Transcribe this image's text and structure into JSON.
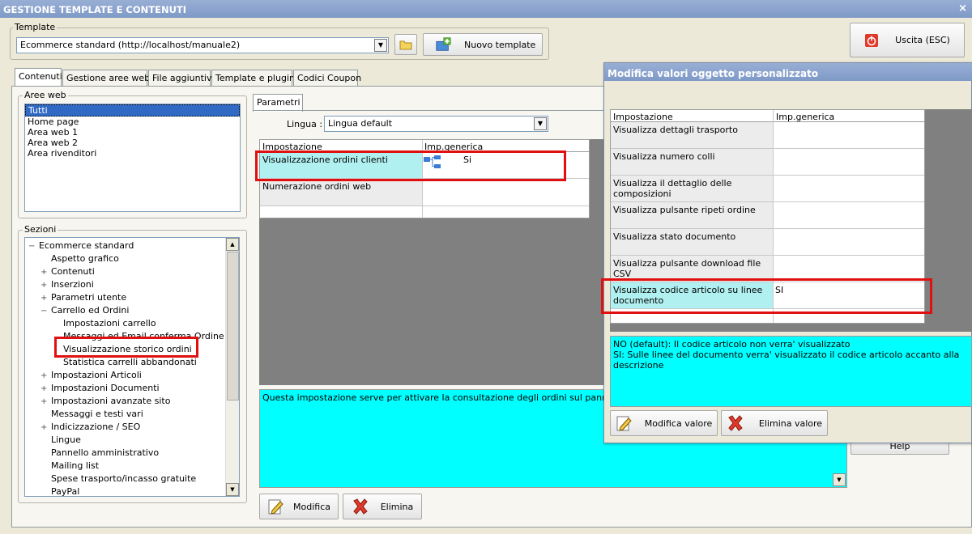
{
  "window": {
    "title": "GESTIONE TEMPLATE E CONTENUTI",
    "close": "×"
  },
  "template": {
    "group_label": "Template",
    "selected": "Ecommerce standard (http://localhost/manuale2)",
    "new_button": "Nuovo template"
  },
  "exit_button": "Uscita (ESC)",
  "tabs": [
    "Contenuti",
    "Gestione aree web",
    "File aggiuntivi",
    "Template e plugins",
    "Codici Coupon"
  ],
  "aree_web": {
    "label": "Aree web",
    "items": [
      "Tutti",
      "Home page",
      "Area web 1",
      "Area web 2",
      "Area rivenditori"
    ],
    "selected_index": 0
  },
  "sezioni": {
    "label": "Sezioni",
    "items": [
      {
        "label": "Ecommerce standard",
        "pm": "−",
        "level": 0
      },
      {
        "label": "Aspetto grafico",
        "pm": "",
        "level": 1
      },
      {
        "label": "Contenuti",
        "pm": "+",
        "level": 1
      },
      {
        "label": "Inserzioni",
        "pm": "+",
        "level": 1
      },
      {
        "label": "Parametri utente",
        "pm": "+",
        "level": 1
      },
      {
        "label": "Carrello ed Ordini",
        "pm": "−",
        "level": 1
      },
      {
        "label": "Impostazioni carrello",
        "pm": "",
        "level": 2
      },
      {
        "label": "Messaggi ed Email conferma Ordine",
        "pm": "",
        "level": 2
      },
      {
        "label": "Visualizzazione storico ordini",
        "pm": "",
        "level": 2
      },
      {
        "label": "Statistica carrelli abbandonati",
        "pm": "",
        "level": 2
      },
      {
        "label": "Impostazioni Articoli",
        "pm": "+",
        "level": 1
      },
      {
        "label": "Impostazioni Documenti",
        "pm": "+",
        "level": 1
      },
      {
        "label": "Impostazioni avanzate sito",
        "pm": "+",
        "level": 1
      },
      {
        "label": "Messaggi e testi vari",
        "pm": "",
        "level": 1
      },
      {
        "label": "Indicizzazione / SEO",
        "pm": "+",
        "level": 1
      },
      {
        "label": "Lingue",
        "pm": "",
        "level": 1
      },
      {
        "label": "Pannello amministrativo",
        "pm": "",
        "level": 1
      },
      {
        "label": "Mailing list",
        "pm": "",
        "level": 1
      },
      {
        "label": "Spese trasporto/incasso gratuite",
        "pm": "",
        "level": 1
      },
      {
        "label": "PayPal",
        "pm": "",
        "level": 1
      }
    ]
  },
  "parametri": {
    "tab": "Parametri",
    "lingua_label": "Lingua :",
    "lingua_value": "Lingua default",
    "col_impostazione": "Impostazione",
    "col_imp": "Imp.generica",
    "rows": [
      {
        "name": "Visualizzazione ordini clienti",
        "value": "Si"
      },
      {
        "name": "Numerazione ordini web",
        "value": ""
      }
    ],
    "description": "Questa impostazione serve per attivare la consultazione degli ordini sul pannello dell'utente",
    "modifica": "Modifica",
    "elimina": "Elimina",
    "help": "Help"
  },
  "dialog": {
    "title": "Modifica valori oggetto personalizzato",
    "col_impostazione": "Impostazione",
    "col_imp": "Imp.generica",
    "rows": [
      {
        "name": "Visualizza dettagli trasporto",
        "value": ""
      },
      {
        "name": "Visualizza numero colli",
        "value": ""
      },
      {
        "name": "Visualizza il dettaglio delle composizioni",
        "value": ""
      },
      {
        "name": "Visualizza pulsante ripeti ordine",
        "value": ""
      },
      {
        "name": "Visualizza stato documento",
        "value": ""
      },
      {
        "name": "Visualizza pulsante download file CSV",
        "value": ""
      },
      {
        "name": "Visualizza codice articolo su linee documento",
        "value": "SI"
      }
    ],
    "info_line1": "NO (default): Il codice articolo non verra' visualizzato",
    "info_line2": "SI: Sulle linee del documento verra' visualizzato il codice articolo accanto alla descrizione",
    "modifica": "Modifica valore",
    "elimina": "Elimina valore"
  }
}
